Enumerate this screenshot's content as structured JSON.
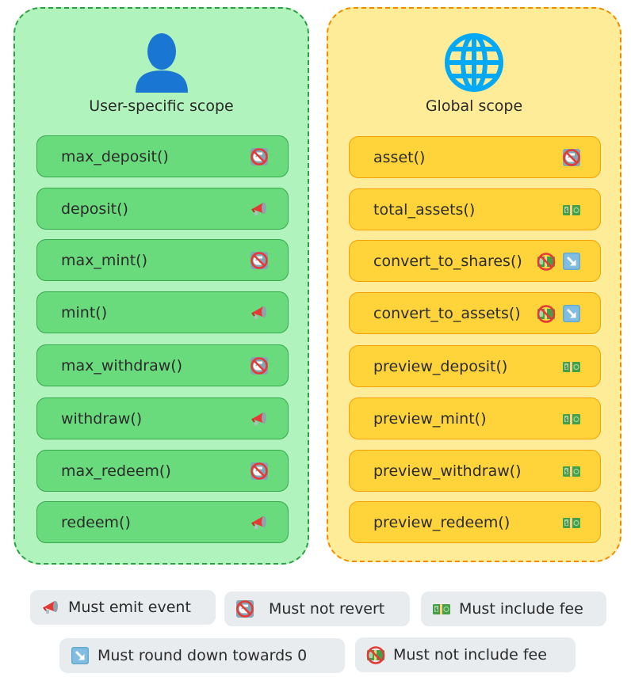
{
  "panels": {
    "user": {
      "title": "User-specific scope",
      "icon": "user-silhouette-icon",
      "functions": [
        {
          "label": "max_deposit()",
          "tags": [
            "no-revert"
          ]
        },
        {
          "label": "deposit()",
          "tags": [
            "emit-event"
          ]
        },
        {
          "label": "max_mint()",
          "tags": [
            "no-revert"
          ]
        },
        {
          "label": "mint()",
          "tags": [
            "emit-event"
          ]
        },
        {
          "label": "max_withdraw()",
          "tags": [
            "no-revert"
          ]
        },
        {
          "label": "withdraw()",
          "tags": [
            "emit-event"
          ]
        },
        {
          "label": "max_redeem()",
          "tags": [
            "no-revert"
          ]
        },
        {
          "label": "redeem()",
          "tags": [
            "emit-event"
          ]
        }
      ]
    },
    "global": {
      "title": "Global scope",
      "icon": "globe-icon",
      "functions": [
        {
          "label": "asset()",
          "tags": [
            "no-revert"
          ]
        },
        {
          "label": "total_assets()",
          "tags": [
            "include-fee"
          ]
        },
        {
          "label": "convert_to_shares()",
          "tags": [
            "no-fee",
            "round-down"
          ]
        },
        {
          "label": "convert_to_assets()",
          "tags": [
            "no-fee",
            "round-down"
          ]
        },
        {
          "label": "preview_deposit()",
          "tags": [
            "include-fee"
          ]
        },
        {
          "label": "preview_mint()",
          "tags": [
            "include-fee"
          ]
        },
        {
          "label": "preview_withdraw()",
          "tags": [
            "include-fee"
          ]
        },
        {
          "label": "preview_redeem()",
          "tags": [
            "include-fee"
          ]
        }
      ]
    }
  },
  "legend": [
    {
      "tag": "emit-event",
      "label": "Must emit event"
    },
    {
      "tag": "no-revert",
      "label": "Must not revert"
    },
    {
      "tag": "include-fee",
      "label": "Must include fee"
    },
    {
      "tag": "round-down",
      "label": "Must round down towards 0"
    },
    {
      "tag": "no-fee",
      "label": "Must not include fee"
    }
  ],
  "colors": {
    "user_bg": "#b1f3bc",
    "user_border": "#2e9e45",
    "user_fn_bg": "#69db7c",
    "global_bg": "#ffec99",
    "global_border": "#f08c00",
    "global_fn_bg": "#ffd43b",
    "legend_bg": "#e9ecef"
  }
}
